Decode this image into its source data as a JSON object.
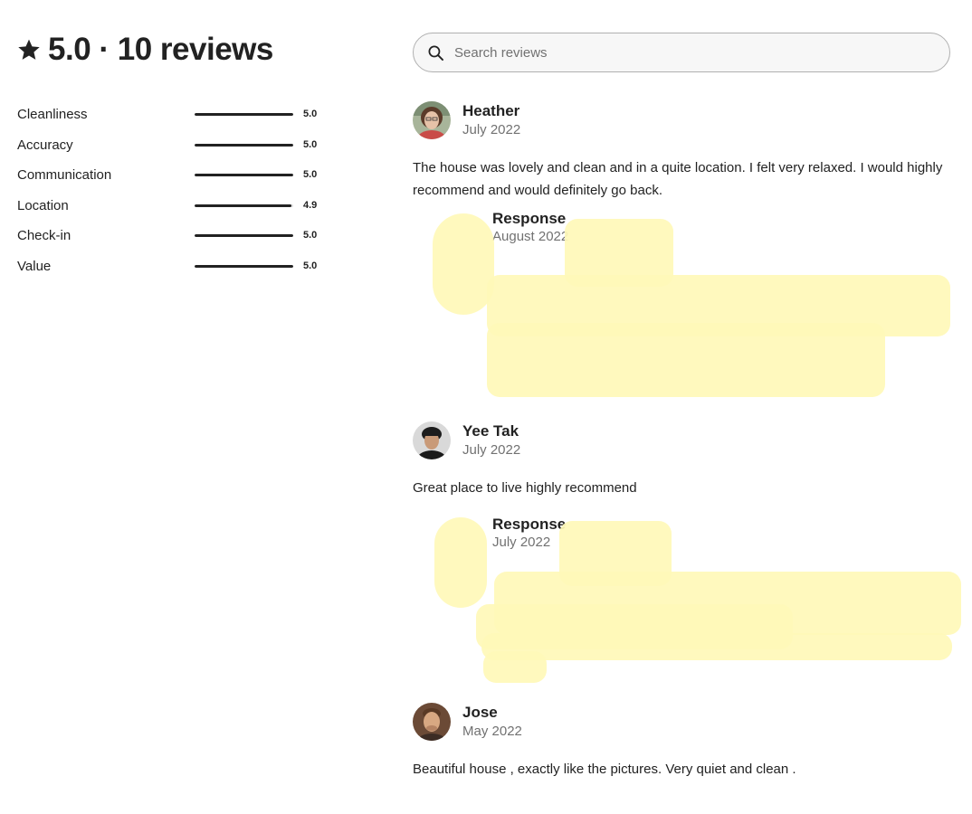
{
  "summary": {
    "title": "5.0 · 10 reviews",
    "icon": "star-icon"
  },
  "categories": [
    {
      "label": "Cleanliness",
      "score": "5.0",
      "fill": 1.0
    },
    {
      "label": "Accuracy",
      "score": "5.0",
      "fill": 1.0
    },
    {
      "label": "Communication",
      "score": "5.0",
      "fill": 1.0
    },
    {
      "label": "Location",
      "score": "4.9",
      "fill": 0.98
    },
    {
      "label": "Check-in",
      "score": "5.0",
      "fill": 1.0
    },
    {
      "label": "Value",
      "score": "5.0",
      "fill": 1.0
    }
  ],
  "search": {
    "placeholder": "Search reviews",
    "icon": "search-icon"
  },
  "reviews": [
    {
      "name": "Heather",
      "date": "July 2022",
      "text": "The house was lovely and clean and in a quite location. I felt very relaxed. I would highly recommend and would definitely go back.",
      "response": {
        "title": "Response",
        "date": "August 2022"
      }
    },
    {
      "name": "Yee Tak",
      "date": "July 2022",
      "text": "Great place to live highly recommend",
      "response": {
        "title": "Response",
        "date": "July 2022"
      }
    },
    {
      "name": "Jose",
      "date": "May 2022",
      "text": "Beautiful house , exactly like the pictures. Very quiet and clean ."
    }
  ],
  "colors": {
    "text": "#222222",
    "muted": "#717171",
    "bar": "#222222",
    "redaction": "#fff9b8"
  }
}
